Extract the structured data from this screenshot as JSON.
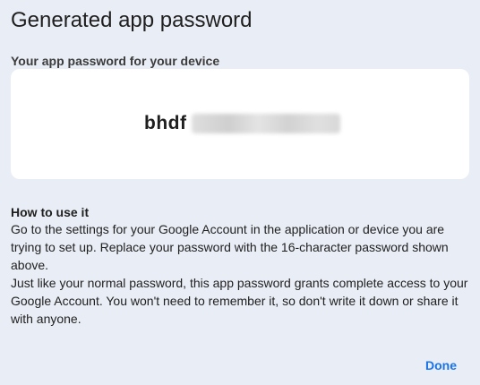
{
  "dialog": {
    "title": "Generated app password",
    "subheading": "Your app password for your device",
    "password_visible": "bhdf",
    "howto": {
      "heading": "How to use it",
      "paragraph1": "Go to the settings for your Google Account in the application or device you are trying to set up. Replace your password with the 16-character password shown above.",
      "paragraph2": "Just like your normal password, this app password grants complete access to your Google Account. You won't need to remember it, so don't write it down or share it with anyone."
    },
    "done_label": "Done"
  },
  "colors": {
    "background": "#e9edf5",
    "card": "#ffffff",
    "accent": "#1a73e8",
    "text": "#1f1f1f"
  }
}
